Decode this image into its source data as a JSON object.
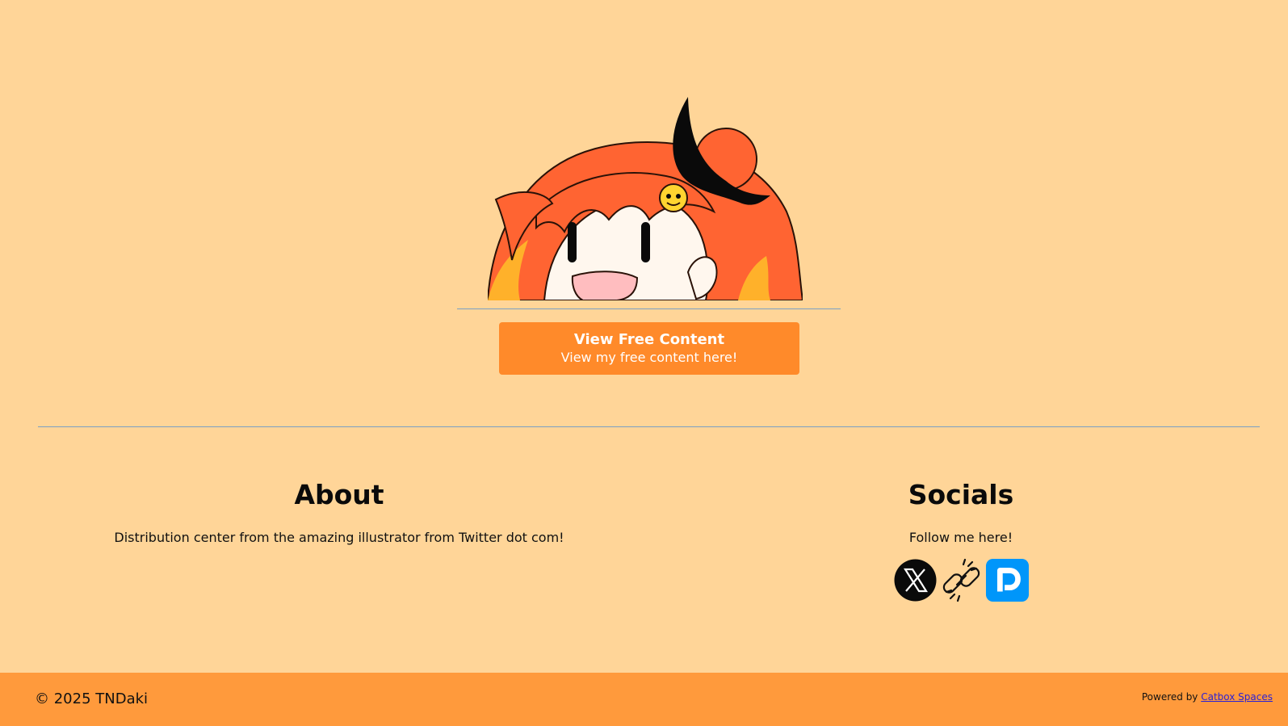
{
  "hero": {
    "image_alt": "anime girl mascot peeking",
    "colors": {
      "hair": "#ff6432",
      "hair_highlight": "#ffb12a",
      "face": "#fff7ee",
      "horn": "#0a0a0a",
      "mouth": "#ffbdbf"
    }
  },
  "cta": {
    "title": "View Free Content",
    "subtitle": "View my free content here!",
    "color": "#ff8a2a"
  },
  "about": {
    "heading": "About",
    "text": "Distribution center from the amazing illustrator from Twitter dot com!"
  },
  "socials": {
    "heading": "Socials",
    "text": "Follow me here!",
    "items": [
      {
        "icon": "x-twitter-icon"
      },
      {
        "icon": "link-chain-icon"
      },
      {
        "icon": "pixiv-icon",
        "color": "#0096fa"
      }
    ]
  },
  "footer": {
    "copyright": "© 2025 TNDaki",
    "powered_prefix": "Powered by ",
    "powered_link": "Catbox Spaces",
    "background": "#ff9a3c"
  },
  "page_background": "#ffd598"
}
